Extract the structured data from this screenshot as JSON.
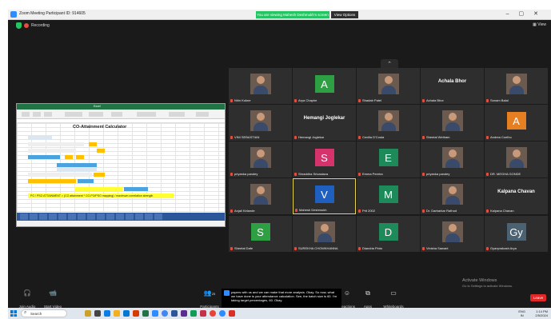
{
  "window": {
    "title": "Zoom Meeting Participant ID: 914605",
    "share_banner": "You are viewing Mahesh Deshmukh's screen",
    "view_options": "View Options"
  },
  "meeting": {
    "recording_label": "Recording",
    "view_label": "View"
  },
  "shared_screen": {
    "calculator_title": "CO-Attainment Calculator",
    "formula_text": "PO / PSO ATTAINMENT = (CO  attainment * CO-PO/PSO mapping) / maximum correlation strength"
  },
  "participants": [
    {
      "name": "Nitin Kokne",
      "display": "photo"
    },
    {
      "name": "Arya Chaphe",
      "display": "avatar",
      "initial": "A",
      "color": "#2ea043"
    },
    {
      "name": "Shadab Patel",
      "display": "photo"
    },
    {
      "name": "Achala Bhor",
      "display": "bigname",
      "big_name": "Achala Bhor"
    },
    {
      "name": "Sonam Balal",
      "display": "photo"
    },
    {
      "name": "VINI SEBASTIAN",
      "display": "photo"
    },
    {
      "name": "Hemangi Joglekar",
      "display": "bigname",
      "big_name": "Hemangi Joglekar"
    },
    {
      "name": "Cecilia D'Costa",
      "display": "photo"
    },
    {
      "name": "Sheetal Wetham",
      "display": "photo"
    },
    {
      "name": "Andrea Coelho",
      "display": "avatar",
      "initial": "A",
      "color": "#e67e22"
    },
    {
      "name": "priyanka pandey",
      "display": "photo"
    },
    {
      "name": "Shraddha Srivastava",
      "display": "avatar",
      "initial": "S",
      "color": "#d6336c"
    },
    {
      "name": "Emma Pereira",
      "display": "avatar",
      "initial": "E",
      "color": "#1e8a5a"
    },
    {
      "name": "priyanka pandey",
      "display": "photo"
    },
    {
      "name": "DR. MEGHA GONDE",
      "display": "photo"
    },
    {
      "name": "Anjali Kirlande",
      "display": "photo"
    },
    {
      "name": "Mahesh Deshmukh",
      "display": "avatar",
      "initial": "V",
      "color": "#1f5fbf",
      "active": true
    },
    {
      "name": "Prit 2002",
      "display": "avatar",
      "initial": "M",
      "color": "#1e8a5a"
    },
    {
      "name": "Dr. Darbarkar Rathod",
      "display": "photo"
    },
    {
      "name": "Kalpana Chavan",
      "display": "bigname",
      "big_name": "Kalpana Chavan"
    },
    {
      "name": "Sheetal Dafe",
      "display": "avatar",
      "initial": "S",
      "color": "#2ea043"
    },
    {
      "name": "SUREKHA CHOWKHANNA",
      "display": "photo"
    },
    {
      "name": "Diandria Pinto",
      "display": "avatar",
      "initial": "D",
      "color": "#1e8a5a"
    },
    {
      "name": "Vinisha Sawant",
      "display": "photo"
    },
    {
      "name": "Gyanprakash Arya",
      "display": "avatar",
      "initial": "Gy",
      "color": "#4a6272"
    }
  ],
  "controls": {
    "join_audio": "Join Audio",
    "start_video": "Start Video",
    "participants": "Participants",
    "participants_count": "25",
    "reactions": "Reactions",
    "apps": "Apps",
    "whiteboards": "Whiteboards",
    "end": "Leave"
  },
  "caption_text": "papers with us and we can make that more analysis. Okay. So now, what we have done is your attendance calculation. See, the batch size is 60. I'm taking target percentages, 60. Okay.",
  "activate_windows": {
    "title": "Activate Windows",
    "subtitle": "Go to Settings to activate Windows."
  },
  "taskbar": {
    "search_label": "Search",
    "lang_line1": "ENG",
    "lang_line2": "IN",
    "time": "1:14 PM",
    "date": "2/5/2024"
  }
}
